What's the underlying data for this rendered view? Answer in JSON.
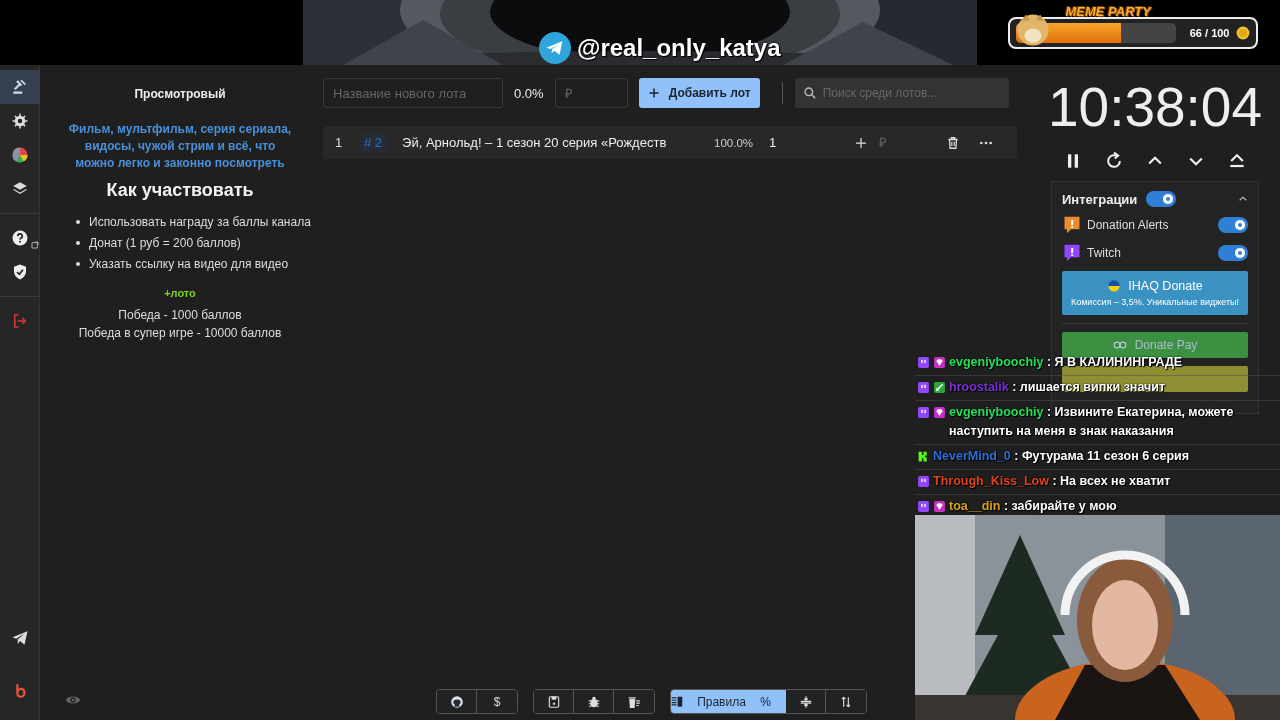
{
  "banner": {
    "kind": "picture",
    "handle": "@real_only_katya"
  },
  "meme_widget": {
    "title": "MEME PARTY",
    "count": "66 / 100",
    "level": 0.66
  },
  "sidebar": {
    "items": [
      {
        "selected": true
      },
      {
        "selected": false
      },
      {
        "selected": false
      },
      {
        "selected": false
      },
      {
        "selected": false
      },
      {
        "selected": false
      },
      {
        "selected": false
      }
    ]
  },
  "info": {
    "title": "Просмотровый",
    "description": "Фильм, мультфильм, серия сериала, видосы, чужой стрим и всё, что можно легко и законно посмотреть",
    "heading": "Как участвовать",
    "steps": [
      "Использовать награду за баллы канала",
      "Донат (1 руб = 200 баллов)",
      "Указать ссылку на видео для видео"
    ],
    "bonus": "+лото",
    "prizes": [
      "Победа - 1000 баллов",
      "Победа в супер игре - 10000 баллов"
    ]
  },
  "toolbar": {
    "name_field": {
      "placeholder": "Название нового лота"
    },
    "percent": "0.0%",
    "amount_field": {
      "placeholder": "₽"
    },
    "add_button": "Добавить лот",
    "search": {
      "placeholder": "Поиск среди лотов..."
    }
  },
  "lots": [
    {
      "index": "1",
      "id": "# 2",
      "name": "Эй, Арнольд! – 1 сезон 20 серия «Рождеств",
      "percent": "100.0%",
      "amount": "1",
      "add_field": {
        "placeholder": "₽"
      }
    }
  ],
  "bottom_toolbar": {
    "groups": [
      {
        "buttons": [
          {
            "selected": false
          },
          {
            "label": "$",
            "selected": false
          }
        ]
      },
      {
        "buttons": [
          {
            "selected": false
          },
          {
            "selected": false
          },
          {
            "selected": false
          }
        ]
      },
      {
        "buttons": [
          {
            "label": "Правила",
            "selected": true
          },
          {
            "label": "%",
            "selected": true
          },
          {
            "selected": false
          },
          {
            "selected": false
          }
        ]
      }
    ]
  },
  "timer": {
    "time": "10:38:04"
  },
  "integrations": {
    "title": "Интеграции",
    "on": true,
    "expanded": true,
    "services": [
      {
        "name": "Donation Alerts",
        "on": true,
        "color": "#e88a2e"
      },
      {
        "name": "Twitch",
        "on": true,
        "color": "#9146ff"
      }
    ],
    "promo": {
      "title": "IHAQ Donate",
      "subtitle": "Комиссия – 3,5%. Уникальные виджеты!"
    },
    "connect_buttons": [
      {
        "label": "Donate Pay",
        "color": "#3e9e45"
      },
      {
        "color": "#9c9a35"
      }
    ]
  },
  "chat": {
    "messages": [
      {
        "badges": [
          {
            "kind": "platform"
          },
          {
            "kind": "gem"
          }
        ],
        "user": "evgeniyboochiy",
        "color": "#22e05a",
        "text": ": Я В КАЛИНИНГРАДЕ"
      },
      {
        "badges": [
          {
            "kind": "platform"
          },
          {
            "kind": "sword"
          }
        ],
        "user": "hroostalik",
        "color": "#7b2fd6",
        "text": ": лишается випки значит"
      },
      {
        "badges": [
          {
            "kind": "platform"
          },
          {
            "kind": "gem"
          }
        ],
        "user": "evgeniyboochiy",
        "color": "#22e05a",
        "text": ": Извините Екатерина, можете наступить на меня в знак наказания"
      },
      {
        "badges": [
          {
            "kind": "kick"
          }
        ],
        "user": "NeverMind_0",
        "color": "#2d6fd8",
        "text": ": Футурама 11 сезон 6 серия"
      },
      {
        "badges": [
          {
            "kind": "platform"
          }
        ],
        "user": "Through_Kiss_Low",
        "color": "#e0431c",
        "text": ": На всех не хватит"
      },
      {
        "badges": [
          {
            "kind": "platform"
          },
          {
            "kind": "gem"
          }
        ],
        "user": "toa__din",
        "color": "#d6a41c",
        "text": ": забирайте у мою"
      }
    ]
  }
}
